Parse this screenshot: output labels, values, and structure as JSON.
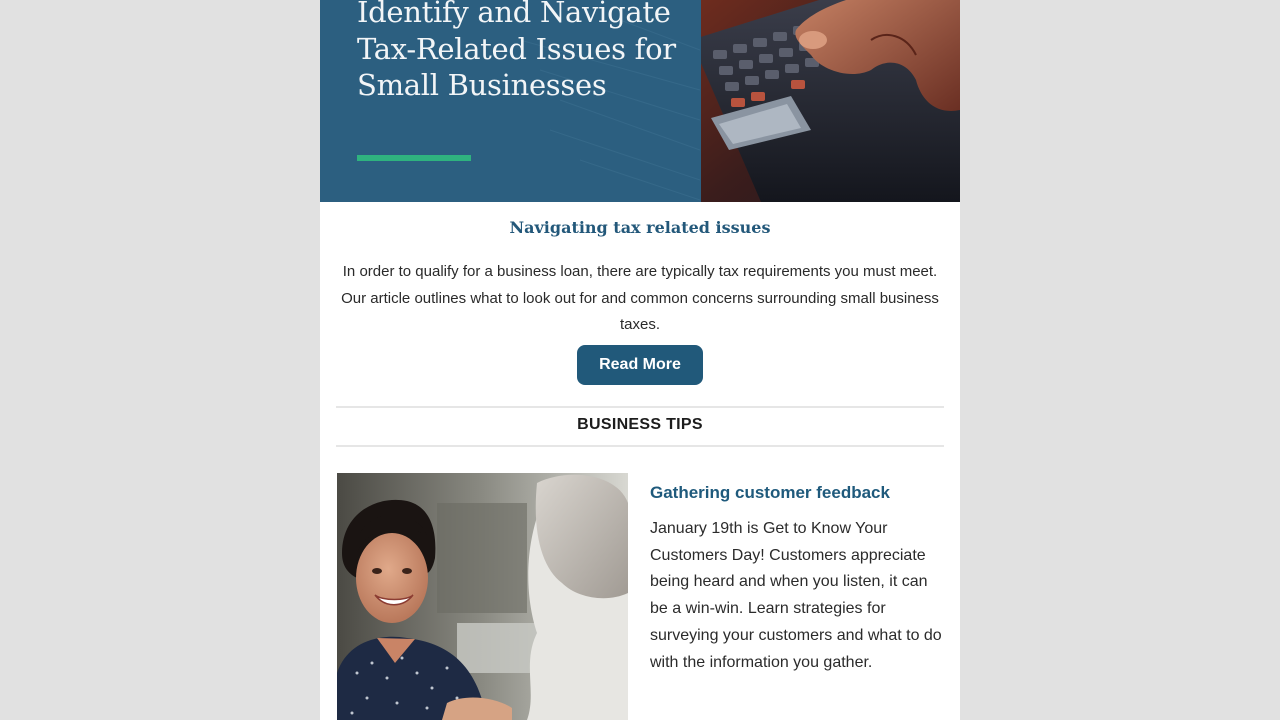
{
  "hero": {
    "title": "Identify and Navigate Tax-Related Issues for Small Businesses",
    "photo_icon": "calculator-photo",
    "accent_color": "#2fb37f",
    "background_color": "#2c5f80"
  },
  "feature": {
    "heading": "Navigating tax related issues",
    "body": "In order to qualify for a business loan, there are typically tax requirements you must meet. Our article outlines what to look out for and common concerns surrounding small business taxes.",
    "button_label": "Read More",
    "button_color": "#21597a"
  },
  "section": {
    "title": "BUSINESS TIPS"
  },
  "tip": {
    "heading": "Gathering customer feedback",
    "body": "January 19th is Get to Know Your Customers Day! Customers appreciate being heard and when you listen, it can be a win-win. Learn strategies for surveying your customers and what to do with the information you gather.",
    "photo_icon": "customer-conversation-photo"
  }
}
